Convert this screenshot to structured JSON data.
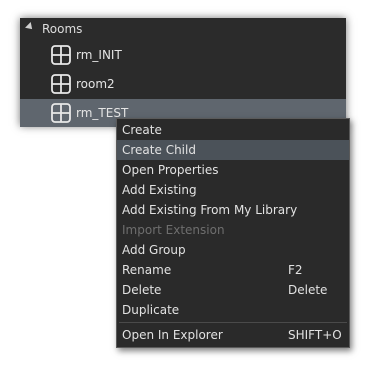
{
  "tree": {
    "folder_label": "Rooms",
    "items": [
      {
        "label": "rm_INIT"
      },
      {
        "label": "room2"
      },
      {
        "label": "rm_TEST"
      }
    ]
  },
  "context_menu": {
    "items": [
      {
        "label": "Create",
        "shortcut": ""
      },
      {
        "label": "Create Child",
        "shortcut": ""
      },
      {
        "label": "Open Properties",
        "shortcut": ""
      },
      {
        "label": "Add Existing",
        "shortcut": ""
      },
      {
        "label": "Add Existing From My Library",
        "shortcut": ""
      },
      {
        "label": "Import Extension",
        "shortcut": ""
      },
      {
        "label": "Add Group",
        "shortcut": ""
      },
      {
        "label": "Rename",
        "shortcut": "F2"
      },
      {
        "label": "Delete",
        "shortcut": "Delete"
      },
      {
        "label": "Duplicate",
        "shortcut": ""
      },
      {
        "label": "Open In Explorer",
        "shortcut": "SHIFT+O"
      }
    ]
  },
  "colors": {
    "panel_bg": "#2b2b2b",
    "selected_bg": "#5f666e",
    "menu_highlight": "#4b5259",
    "disabled_text": "#6e6e6e"
  },
  "icons": {
    "folder_expander": "expand-triangle-icon",
    "room": "room-grid-icon"
  }
}
